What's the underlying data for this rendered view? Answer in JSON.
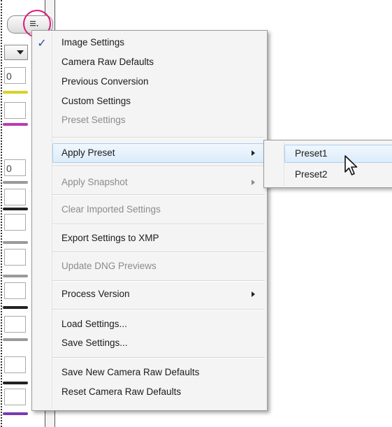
{
  "background_panel": {
    "field_values": [
      "0",
      "0"
    ],
    "slider_colors": [
      "#d6d22a",
      "#b83cb3",
      "#9a9a9a",
      "#222222",
      "#9a9a9a",
      "#9a9a9a",
      "#222222",
      "#9a9a9a",
      "#222222",
      "#7a3ab0"
    ]
  },
  "menu": {
    "items": [
      {
        "label": "Image Settings",
        "checked": true,
        "enabled": true
      },
      {
        "label": "Camera Raw Defaults",
        "enabled": true
      },
      {
        "label": "Previous Conversion",
        "enabled": true
      },
      {
        "label": "Custom Settings",
        "enabled": true
      },
      {
        "label": "Preset Settings",
        "enabled": false
      },
      {
        "label": "Apply Preset",
        "enabled": true,
        "submenu": true,
        "highlighted": true
      },
      {
        "label": "Apply Snapshot",
        "enabled": false,
        "submenu": true
      },
      {
        "label": "Clear Imported Settings",
        "enabled": false
      },
      {
        "label": "Export Settings to XMP",
        "enabled": true
      },
      {
        "label": "Update DNG Previews",
        "enabled": false
      },
      {
        "label": "Process Version",
        "enabled": true,
        "submenu": true
      },
      {
        "label": "Load Settings...",
        "enabled": true
      },
      {
        "label": "Save Settings...",
        "enabled": true
      },
      {
        "label": "Save New Camera Raw Defaults",
        "enabled": true
      },
      {
        "label": "Reset Camera Raw Defaults",
        "enabled": true
      }
    ]
  },
  "submenu": {
    "items": [
      {
        "label": "Preset1",
        "highlighted": true
      },
      {
        "label": "Preset2"
      }
    ]
  },
  "colors": {
    "highlight_circle": "#e0187b",
    "hover_fill": "#dcecfa",
    "hover_border": "#a9cdf0",
    "check": "#1e4f9c",
    "disabled_text": "#8b8b8b"
  },
  "icons": [
    "flyout-menu-icon",
    "checkmark-icon",
    "submenu-arrow-icon",
    "mouse-pointer-icon",
    "dropdown-arrow-icon"
  ]
}
